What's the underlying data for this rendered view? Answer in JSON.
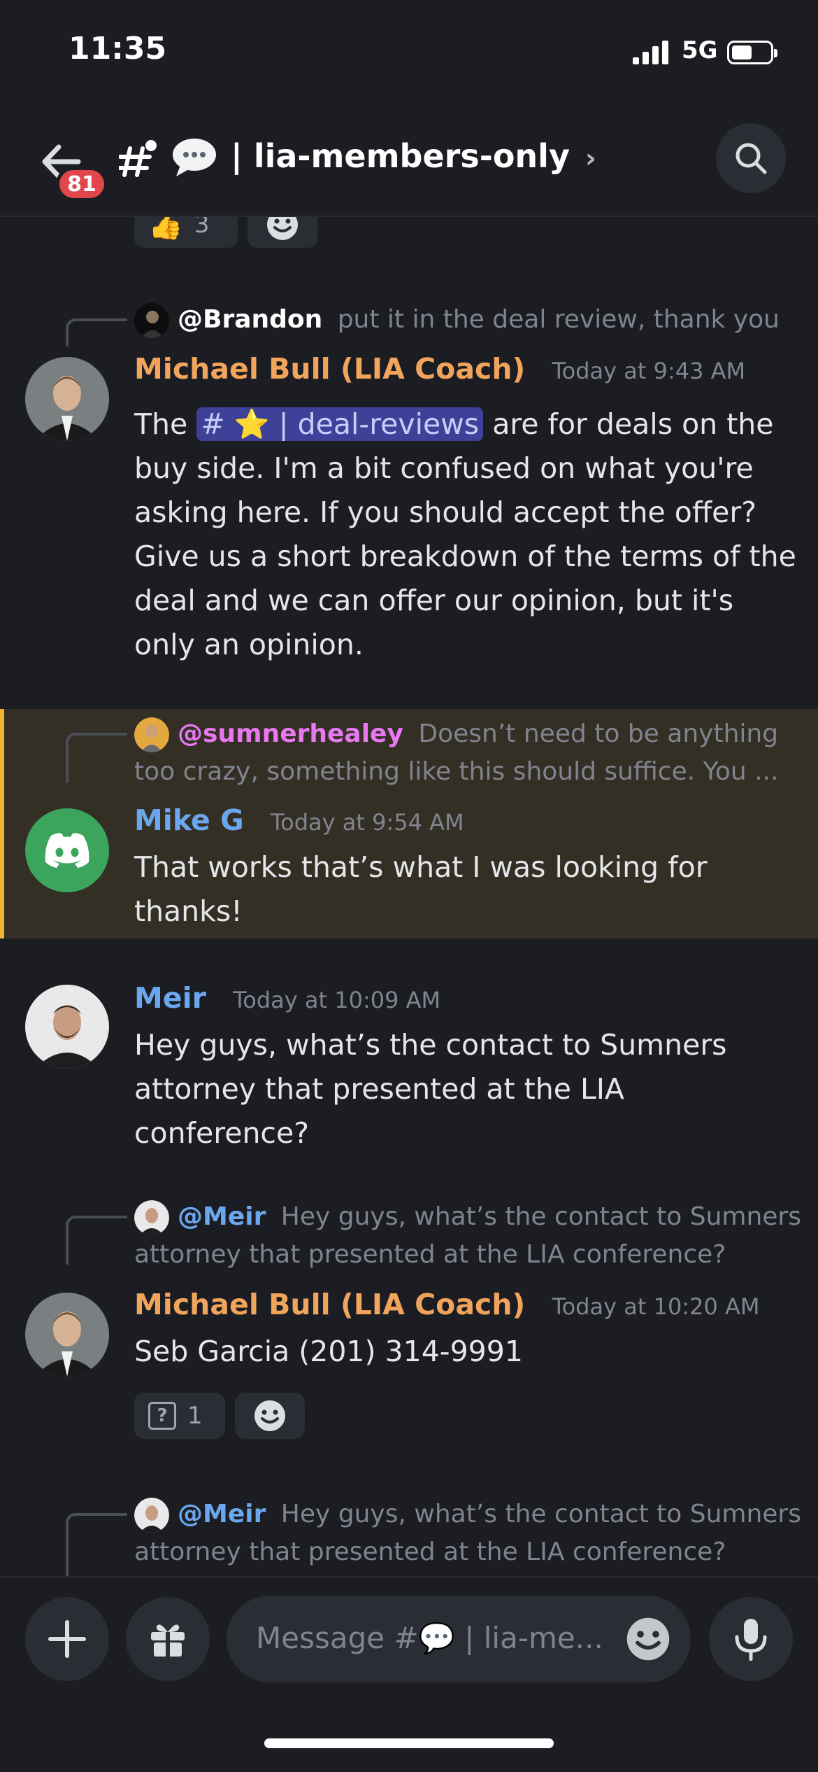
{
  "status": {
    "time": "11:35",
    "network": "5G"
  },
  "header": {
    "badge": "81",
    "channel_title": "| lia-members-only",
    "chevron": "›"
  },
  "top_reactions": [
    {
      "emoji": "👍",
      "count": "3"
    }
  ],
  "messages": [
    {
      "reply_to": {
        "author": "@Brandon",
        "text": "put it in the deal review, thank you"
      },
      "author": "Michael Bull (LIA Coach)",
      "author_color": "#f0a45c",
      "timestamp": "Today at 9:43 AM",
      "body_before": "The",
      "channel_mention": "# ⭐ | deal-reviews",
      "body_after": "are for deals on the buy side. I'm a bit confused on what you're asking here. If you should accept the offer? Give us a short breakdown of the terms of the deal and we can offer our opinion, but it's only an opinion."
    },
    {
      "reply_to": {
        "author": "@sumnerhealey",
        "author_color": "#e878f2",
        "text_line1": "Doesn’t need to be anything",
        "text_line2": "too crazy, something like this should suffice.   You ..."
      },
      "author": "Mike G",
      "author_color": "#6aa7ee",
      "timestamp": "Today at 9:54 AM",
      "body": "That works that’s what I was looking for thanks!",
      "highlight_color": "#f0b232"
    },
    {
      "author": "Meir",
      "author_color": "#6aa7ee",
      "timestamp": "Today at 10:09 AM",
      "body": "Hey guys, what’s the contact to Sumners attorney that presented at the LIA conference?"
    },
    {
      "reply_to": {
        "author": "@Meir",
        "author_color": "#6aa7ee",
        "text_line1": "Hey guys, what’s the contact to Sumners",
        "text_line2": "attorney that presented at the LIA conference?"
      },
      "author": "Michael Bull (LIA Coach)",
      "author_color": "#f0a45c",
      "timestamp": "Today at 10:20 AM",
      "body": "Seb Garcia (201) 314-9991",
      "reactions": [
        {
          "emoji": "?",
          "count": "1"
        }
      ]
    },
    {
      "reply_to": {
        "author": "@Meir",
        "author_color": "#6aa7ee",
        "text_line1": "Hey guys, what’s the contact to Sumners",
        "text_line2": "attorney that presented at the LIA conference?"
      }
    }
  ],
  "composer": {
    "placeholder": "Message #💬 | lia-me..."
  },
  "icons": [
    "back-arrow-icon",
    "thread-icon",
    "search-icon",
    "thumbs-up-icon",
    "add-reaction-icon",
    "plus-icon",
    "gift-icon",
    "emoji-icon",
    "microphone-icon",
    "discord-logo-icon"
  ]
}
